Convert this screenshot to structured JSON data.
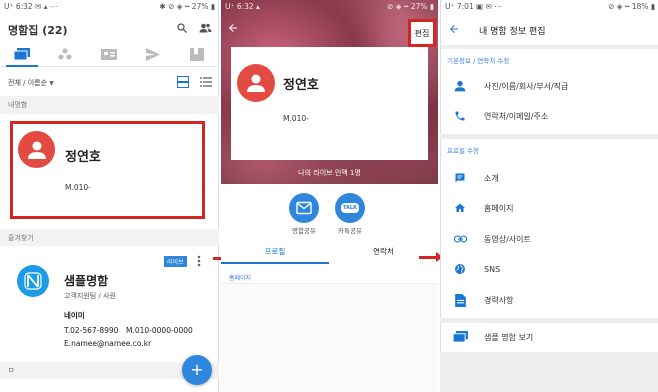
{
  "colors": {
    "accent": "#1976d2",
    "brand_red": "#e24a42",
    "highlight_red": "#d42424",
    "fab": "#2f86dd",
    "label_blue": "#3d7fe0"
  },
  "screen1": {
    "status": {
      "left": "U⁺ 6:32 ✉ ▴ ⋯",
      "right": "✱ ⊘ ◈ ╍ 27% ▮"
    },
    "title": "명함집 (22)",
    "icons": [
      "search-icon",
      "add-person-icon",
      "cards-tab-icon",
      "group-tab-icon",
      "card-view-tab-icon",
      "send-tab-icon",
      "bookmark-tab-icon"
    ],
    "sort": "전체 / 이름순",
    "my_card_section": "내명함",
    "my_card": {
      "name": "정연호",
      "phone": "M.010-"
    },
    "favorites_section": "즐겨찾기",
    "fav_card": {
      "badge": "라이브",
      "title": "샘플명함",
      "subtitle": "고객지원팀 / 사원",
      "company": "네이미",
      "tel": "T.02-567-8990",
      "mobile": "M.010-0000-0000",
      "email": "E.namee@namee.co.kr"
    },
    "bottom_letter": "ㅁ",
    "fab_icon": "+"
  },
  "screen2": {
    "status": {
      "left": "U⁺ 6:32 ▴",
      "right": "⊘ ◈ ╍ 27% ▮"
    },
    "edit": "편집",
    "card": {
      "name": "정연호",
      "phone": "M.010-"
    },
    "network": "나의 라이브 인맥 1명",
    "share1": "명함공유",
    "share2": "카톡공유",
    "talk_badge": "TALK",
    "tabs": [
      "프로필",
      "연락처"
    ],
    "homepage_label": "홈페이지"
  },
  "screen3": {
    "status": {
      "left": "U⁺ 7:01 ▣ ✉ ⋯",
      "right": "⊘ ◈ ╍ 18% ▮"
    },
    "title": "내 명함 정보 편집",
    "section1": "기본정보 / 연락처 수정",
    "items1": [
      {
        "icon": "person-icon",
        "label": "사진/이름/회사/부서/직급"
      },
      {
        "icon": "phone-icon",
        "label": "연락처/이메일/주소"
      }
    ],
    "section2": "프로필 수정",
    "items2": [
      {
        "icon": "chat-icon",
        "label": "소개"
      },
      {
        "icon": "home-icon",
        "label": "홈페이지"
      },
      {
        "icon": "link-icon",
        "label": "동영상/사이트"
      },
      {
        "icon": "globe-icon",
        "label": "SNS"
      },
      {
        "icon": "document-icon",
        "label": "경력사항"
      }
    ],
    "view_item": {
      "icon": "cards-icon",
      "label": "샘플 명함 보기"
    }
  }
}
